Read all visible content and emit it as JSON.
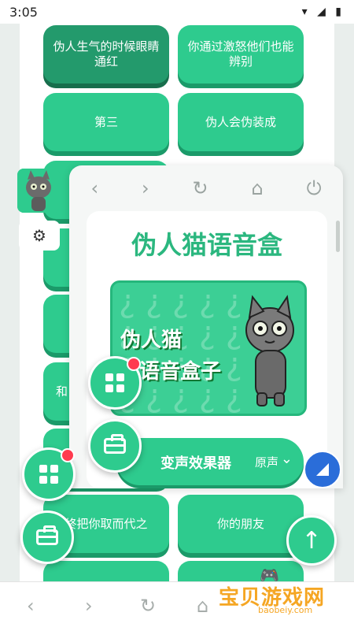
{
  "status_bar": {
    "time": "3:05",
    "icons": "▾ ◢ ▮"
  },
  "tiles": [
    {
      "text": "伪人生气的时候眼睛通红"
    },
    {
      "text": "你通过激怒他们也能辨别"
    },
    {
      "text": "第三"
    },
    {
      "text": "伪人会伪装成"
    },
    {
      "text": "和"
    },
    {
      "text": "终把你取而代之"
    },
    {
      "text": "你的朋友"
    }
  ],
  "panel": {
    "nav": {
      "back": "‹",
      "forward": "›",
      "refresh": "↻",
      "home": "⌂",
      "power": "⏻"
    },
    "title": "伪人猫语音盒",
    "banner": {
      "line1": "伪人猫",
      "line2": "语音盒子",
      "qmarks": "¿ ¿ ¿ ¿ ¿\n¿ ¿ ¿ ¿ ¿\n¿ ¿ ¿ ¿ ¿\n¿ ¿ ¿ ¿ ¿"
    },
    "effect": {
      "label": "变声效果器",
      "value": "原声",
      "chevron": "⌄"
    }
  },
  "side": {
    "settings_icon": "⚙"
  },
  "up_button": "↑",
  "bottom_nav": {
    "back": "‹",
    "forward": "›",
    "refresh": "↻",
    "home": "⌂"
  },
  "watermark": {
    "cn": "宝贝游戏网",
    "en": "baobeiy.com",
    "pad": "🎮"
  }
}
